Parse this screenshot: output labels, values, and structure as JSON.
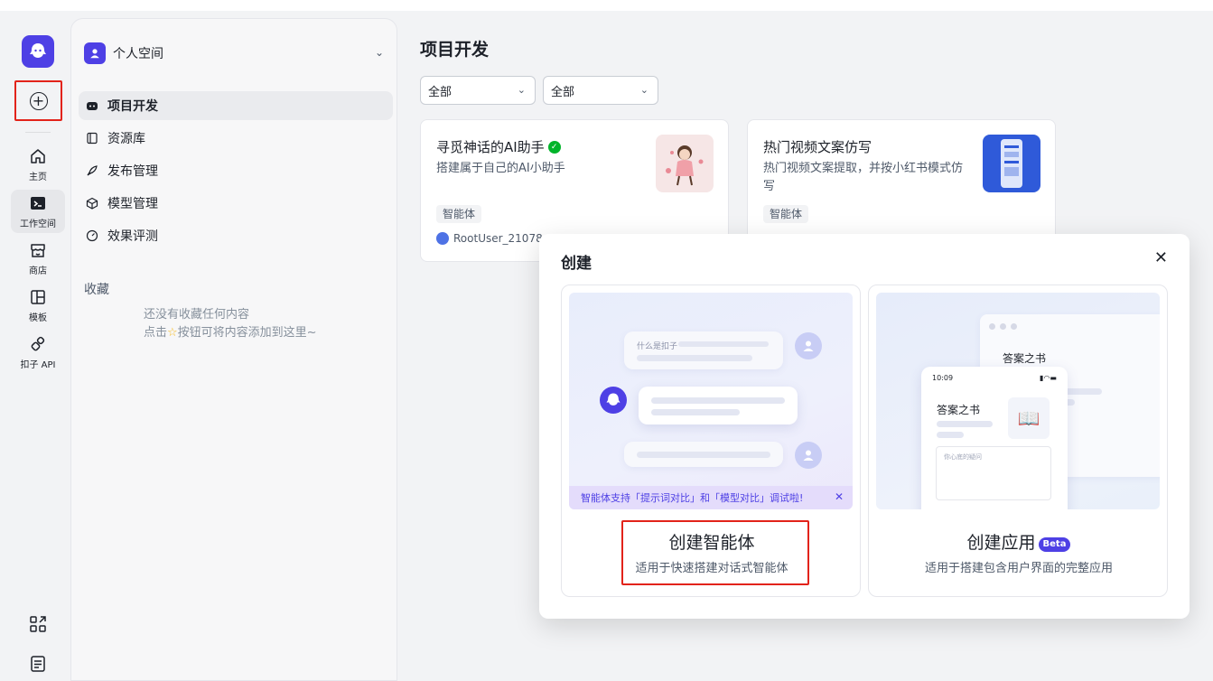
{
  "rail": {
    "items": [
      {
        "label": "主页",
        "icon": "home-icon"
      },
      {
        "label": "工作空间",
        "icon": "workspace-icon"
      },
      {
        "label": "商店",
        "icon": "store-icon"
      },
      {
        "label": "模板",
        "icon": "template-icon"
      },
      {
        "label": "扣子 API",
        "icon": "api-icon"
      }
    ]
  },
  "sidebar": {
    "space_name": "个人空间",
    "nav": [
      {
        "label": "项目开发"
      },
      {
        "label": "资源库"
      },
      {
        "label": "发布管理"
      },
      {
        "label": "模型管理"
      },
      {
        "label": "效果评测"
      }
    ],
    "favorites_title": "收藏",
    "favorites_empty_line1": "还没有收藏任何内容",
    "favorites_empty_pre": "点击",
    "favorites_empty_post": "按钮可将内容添加到这里~"
  },
  "main": {
    "title": "项目开发",
    "filter1": "全部",
    "filter2": "全部",
    "cards": [
      {
        "title": "寻觅神话的AI助手",
        "desc": "搭建属于自己的AI小助手",
        "tag": "智能体",
        "author": "RootUser_21078"
      },
      {
        "title": "热门视频文案仿写",
        "desc": "热门视频文案提取，并按小红书模式仿写",
        "tag": "智能体"
      }
    ]
  },
  "modal": {
    "title": "创建",
    "close": "✕",
    "agent": {
      "preview_question": "什么是扣子",
      "banner": "智能体支持「提示词对比」和「模型对比」调试啦!",
      "banner_close": "✕",
      "name": "创建智能体",
      "desc": "适用于快速搭建对话式智能体"
    },
    "app": {
      "window_title": "答案之书",
      "phone_time": "10:09",
      "phone_title": "答案之书",
      "phone_input_placeholder": "你心底的疑问",
      "book_icon": "📖",
      "name": "创建应用",
      "badge": "Beta",
      "desc": "适用于搭建包含用户界面的完整应用"
    }
  },
  "colors": {
    "brand": "#4e40e5",
    "highlight": "#e2231a",
    "verified": "#00b42a"
  }
}
